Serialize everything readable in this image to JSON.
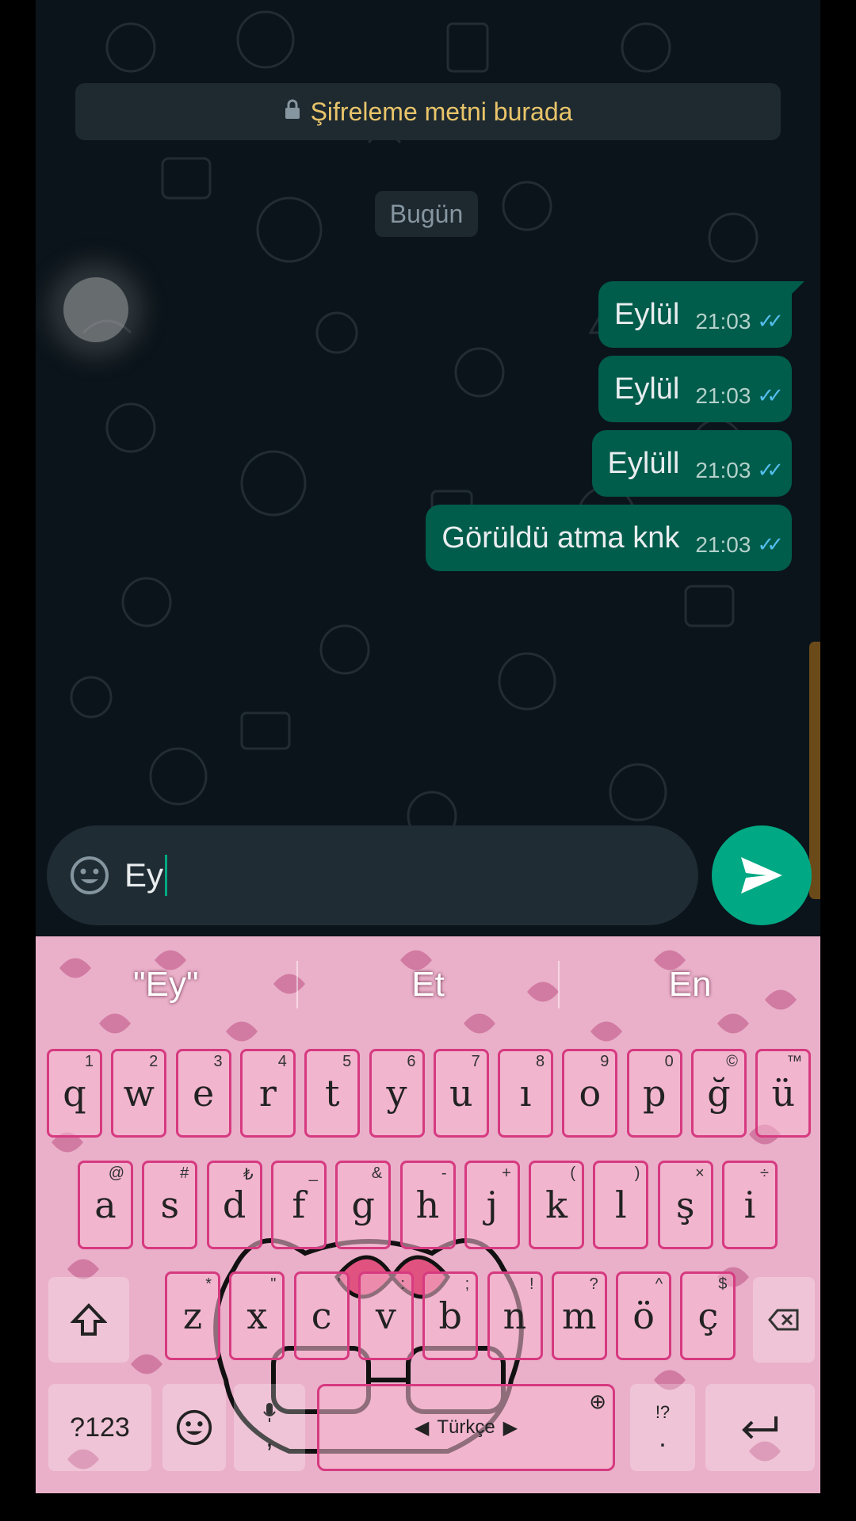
{
  "chat": {
    "encryption_notice": "Şifreleme metni burada",
    "date_chip": "Bugün",
    "messages": [
      {
        "text": "Eylül",
        "time": "21:03",
        "status": "read"
      },
      {
        "text": "Eylül",
        "time": "21:03",
        "status": "read"
      },
      {
        "text": "Eylüll",
        "time": "21:03",
        "status": "read"
      },
      {
        "text": "Görüldü atma knk",
        "time": "21:03",
        "status": "read"
      }
    ]
  },
  "composer": {
    "value": "Ey",
    "send_icon": "send-icon",
    "emoji_icon": "emoji-icon"
  },
  "keyboard": {
    "suggestions": [
      "\"Ey\"",
      "Et",
      "En"
    ],
    "row1": [
      {
        "k": "q",
        "h": "1"
      },
      {
        "k": "w",
        "h": "2"
      },
      {
        "k": "e",
        "h": "3"
      },
      {
        "k": "r",
        "h": "4"
      },
      {
        "k": "t",
        "h": "5"
      },
      {
        "k": "y",
        "h": "6"
      },
      {
        "k": "u",
        "h": "7"
      },
      {
        "k": "ı",
        "h": "8"
      },
      {
        "k": "o",
        "h": "9"
      },
      {
        "k": "p",
        "h": "0"
      },
      {
        "k": "ğ",
        "h": "©"
      },
      {
        "k": "ü",
        "h": "™"
      }
    ],
    "row2": [
      {
        "k": "a",
        "h": "@"
      },
      {
        "k": "s",
        "h": "#"
      },
      {
        "k": "d",
        "h": "₺"
      },
      {
        "k": "f",
        "h": "_"
      },
      {
        "k": "g",
        "h": "&"
      },
      {
        "k": "h",
        "h": "-"
      },
      {
        "k": "j",
        "h": "+"
      },
      {
        "k": "k",
        "h": "("
      },
      {
        "k": "l",
        "h": ")"
      },
      {
        "k": "ş",
        "h": "×"
      },
      {
        "k": "i",
        "h": "÷"
      }
    ],
    "row3": [
      {
        "k": "z",
        "h": "*"
      },
      {
        "k": "x",
        "h": "\""
      },
      {
        "k": "c",
        "h": "'"
      },
      {
        "k": "v",
        "h": ":"
      },
      {
        "k": "b",
        "h": ";"
      },
      {
        "k": "n",
        "h": "!"
      },
      {
        "k": "m",
        "h": "?"
      },
      {
        "k": "ö",
        "h": "^"
      },
      {
        "k": "ç",
        "h": "$"
      }
    ],
    "symbols_label": "?123",
    "comma_label": ",",
    "space_label": "Türkçe",
    "period_label": ".",
    "period_hint": "!?",
    "colors": {
      "accent": "#d63a80",
      "bubble_out": "#005c4b",
      "send": "#00a884",
      "ticks": "#53bdeb"
    }
  }
}
